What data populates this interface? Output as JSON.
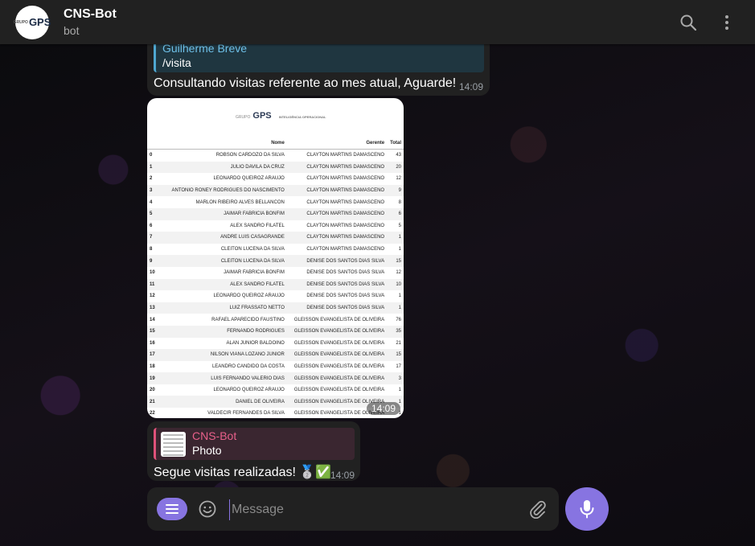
{
  "header": {
    "title": "CNS-Bot",
    "subtitle": "bot",
    "avatar_text": "GPS",
    "avatar_small": "GRUPO"
  },
  "messages": [
    {
      "reply_name": "Guilherme Breve",
      "reply_text": "/visita",
      "text": "Consultando visitas referente ao mes atual, Aguarde!",
      "time": "14:09"
    },
    {
      "type": "photo",
      "time": "14:09",
      "photo": {
        "logo_small": "GRUPO",
        "logo": "GPS",
        "logo_right": "INTELIGÊNCIA OPERACIONAL",
        "headers": [
          "",
          "Nome",
          "Gerente",
          "Total"
        ],
        "rows": [
          [
            "0",
            "ROBSON CARDOZO DA SILVA",
            "CLAYTON MARTINS DAMASCENO",
            "43"
          ],
          [
            "1",
            "JULIO DAVILA DA CRUZ",
            "CLAYTON MARTINS DAMASCENO",
            "20"
          ],
          [
            "2",
            "LEONARDO QUEIROZ ARAUJO",
            "CLAYTON MARTINS DAMASCENO",
            "12"
          ],
          [
            "3",
            "ANTONIO RONEY RODRIGUES DO NASCIMENTO",
            "CLAYTON MARTINS DAMASCENO",
            "9"
          ],
          [
            "4",
            "MARLON RIBEIRO ALVES BELLANCON",
            "CLAYTON MARTINS DAMASCENO",
            "8"
          ],
          [
            "5",
            "JAIMAR FABRICIA BONFIM",
            "CLAYTON MARTINS DAMASCENO",
            "6"
          ],
          [
            "6",
            "ALEX SANDRO FILATEL",
            "CLAYTON MARTINS DAMASCENO",
            "5"
          ],
          [
            "7",
            "ANDRE LUIS CASAGRANDE",
            "CLAYTON MARTINS DAMASCENO",
            "1"
          ],
          [
            "8",
            "CLEITON LUCENA DA SILVA",
            "CLAYTON MARTINS DAMASCENO",
            "1"
          ],
          [
            "9",
            "CLEITON LUCENA DA SILVA",
            "DENISE DOS SANTOS DIAS SILVA",
            "15"
          ],
          [
            "10",
            "JAIMAR FABRICIA BONFIM",
            "DENISE DOS SANTOS DIAS SILVA",
            "12"
          ],
          [
            "11",
            "ALEX SANDRO FILATEL",
            "DENISE DOS SANTOS DIAS SILVA",
            "10"
          ],
          [
            "12",
            "LEONARDO QUEIROZ ARAUJO",
            "DENISE DOS SANTOS DIAS SILVA",
            "1"
          ],
          [
            "13",
            "LUIZ FRASSATO NETTO",
            "DENISE DOS SANTOS DIAS SILVA",
            "1"
          ],
          [
            "14",
            "RAFAEL APARECIDO FAUSTINO",
            "GLEISSON EVANGELISTA DE OLIVEIRA",
            "76"
          ],
          [
            "15",
            "FERNANDO RODRIGUES",
            "GLEISSON EVANGELISTA DE OLIVEIRA",
            "35"
          ],
          [
            "16",
            "ALAN JUNIOR BALDOINO",
            "GLEISSON EVANGELISTA DE OLIVEIRA",
            "21"
          ],
          [
            "17",
            "NILSON VIANA LOZANO JUNIOR",
            "GLEISSON EVANGELISTA DE OLIVEIRA",
            "15"
          ],
          [
            "18",
            "LEANDRO CANDIDO DA COSTA",
            "GLEISSON EVANGELISTA DE OLIVEIRA",
            "17"
          ],
          [
            "19",
            "LUIS FERNANDO VALERIO DIAS",
            "GLEISSON EVANGELISTA DE OLIVEIRA",
            "3"
          ],
          [
            "20",
            "LEONARDO QUEIROZ ARAUJO",
            "GLEISSON EVANGELISTA DE OLIVEIRA",
            "1"
          ],
          [
            "21",
            "DANIEL DE OLIVEIRA",
            "GLEISSON EVANGELISTA DE OLIVEIRA",
            "1"
          ],
          [
            "22",
            "VALDECIR FERNANDES DA SILVA",
            "GLEISSON EVANGELISTA DE OLIVEIRA",
            "1"
          ]
        ]
      }
    },
    {
      "reply_name": "CNS-Bot",
      "reply_text": "Photo",
      "text": "Segue visitas realizadas! 🥈✅",
      "time": "14:09"
    }
  ],
  "composer": {
    "placeholder": "Message"
  },
  "colors": {
    "accent": "#8774e1",
    "header_bg": "#212121",
    "bubble_bg": "#212121"
  },
  "icons": [
    "search-icon",
    "more-vertical-icon",
    "menu-icon",
    "emoji-icon",
    "attach-icon",
    "mic-icon"
  ]
}
